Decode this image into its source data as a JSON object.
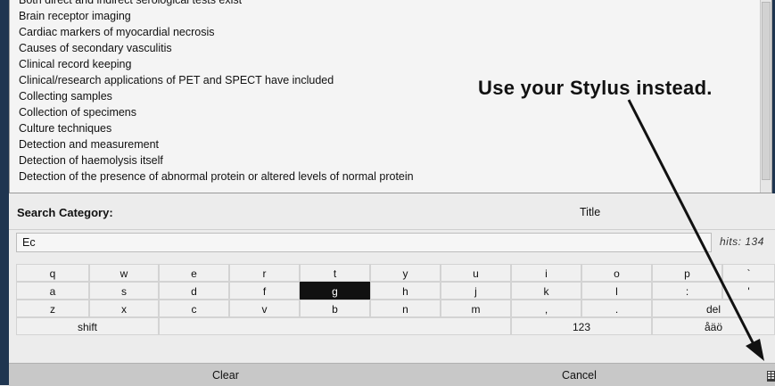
{
  "list": {
    "items": [
      "Both direct and indirect serological tests exist",
      "Brain receptor imaging",
      "Cardiac markers of myocardial necrosis",
      "Causes of secondary vasculitis",
      "Clinical record keeping",
      "Clinical/research applications of PET and SPECT have included",
      "Collecting samples",
      "Collection of specimens",
      "Culture techniques",
      "Detection and measurement",
      "Detection of haemolysis itself",
      "Detection of the presence of abnormal protein or altered levels of normal protein"
    ]
  },
  "search": {
    "category_label": "Search Category:",
    "category_value": "Title",
    "query": "Ec",
    "hits": "hits: 134"
  },
  "keyboard": {
    "row1": [
      "q",
      "w",
      "e",
      "r",
      "t",
      "y",
      "u",
      "i",
      "o",
      "p",
      "`"
    ],
    "row2": [
      "a",
      "s",
      "d",
      "f",
      "g",
      "h",
      "j",
      "k",
      "l",
      ":",
      "'"
    ],
    "row3": [
      "z",
      "x",
      "c",
      "v",
      "b",
      "n",
      "m",
      ",",
      ".",
      "del"
    ],
    "row4": [
      "shift",
      "",
      "123",
      "åäö"
    ],
    "pressed_key": "g"
  },
  "actions": {
    "clear": "Clear",
    "cancel": "Cancel"
  },
  "overlay": {
    "text": "Use your Stylus instead."
  },
  "colors": {
    "frame": "#1f3550",
    "pressed_key": "#111111"
  }
}
